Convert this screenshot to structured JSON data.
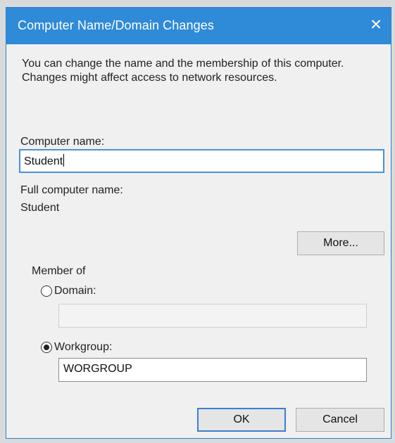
{
  "window": {
    "title": "Computer Name/Domain Changes",
    "close_glyph": "✕"
  },
  "description": "You can change the name and the membership of this computer. Changes might affect access to network resources.",
  "computer_name": {
    "label": "Computer name:",
    "value": "Student"
  },
  "full_name": {
    "label": "Full computer name:",
    "value": "Student"
  },
  "buttons": {
    "more": "More...",
    "ok": "OK",
    "cancel": "Cancel"
  },
  "membership": {
    "label": "Member of",
    "domain_label": "Domain:",
    "domain_value": "",
    "domain_selected": false,
    "workgroup_label": "Workgroup:",
    "workgroup_value": "WORGROUP",
    "workgroup_selected": true
  },
  "colors": {
    "titlebar": "#2f8ad8",
    "dialog_bg": "#f0f0f0",
    "focus_border": "#4a90d9"
  }
}
